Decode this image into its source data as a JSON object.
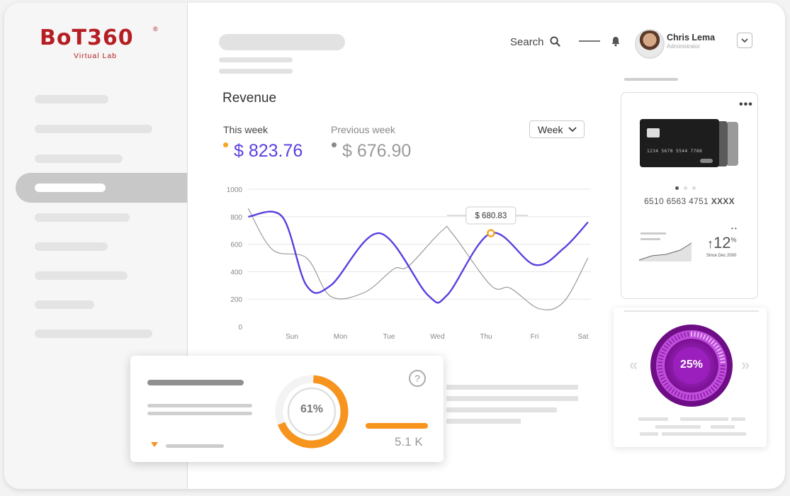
{
  "brand": {
    "name": "BoT360",
    "registered": "®",
    "subtitle": "Virtual Lab",
    "color": "#b51f24"
  },
  "header": {
    "search_label": "Search",
    "user": {
      "name": "Chris Lema",
      "role": "Administrator"
    }
  },
  "revenue": {
    "title": "Revenue",
    "this_week_label": "This week",
    "this_week_value": "$ 823.76",
    "previous_week_label": "Previous week",
    "previous_week_value": "$ 676.90",
    "period_select": "Week",
    "accent": "#5b3fe0",
    "secondary": "#9a9a9a"
  },
  "chart_data": {
    "type": "line",
    "categories": [
      "Sun",
      "Mon",
      "Tue",
      "Wed",
      "Thu",
      "Fri",
      "Sat"
    ],
    "y_ticks": [
      "0",
      "200",
      "400",
      "600",
      "800",
      "1000"
    ],
    "ylim": [
      0,
      1000
    ],
    "grid": true,
    "series": [
      {
        "color": "#5b3fe0",
        "points": [
          [
            -0.9,
            800
          ],
          [
            -0.2,
            800
          ],
          [
            0.3,
            300
          ],
          [
            0.8,
            300
          ],
          [
            1.8,
            680
          ],
          [
            2.8,
            230
          ],
          [
            3.2,
            230
          ],
          [
            4.1,
            680
          ],
          [
            5,
            450
          ],
          [
            5.6,
            570
          ],
          [
            6.1,
            760
          ]
        ]
      },
      {
        "color": "#9a9a9a",
        "points": [
          [
            -0.9,
            860
          ],
          [
            -0.4,
            560
          ],
          [
            0.3,
            500
          ],
          [
            0.8,
            220
          ],
          [
            1.5,
            250
          ],
          [
            2.1,
            420
          ],
          [
            2.4,
            440
          ],
          [
            3.1,
            700
          ],
          [
            3.3,
            680
          ],
          [
            4.1,
            300
          ],
          [
            4.5,
            280
          ],
          [
            5.1,
            130
          ],
          [
            5.6,
            180
          ],
          [
            6.1,
            500
          ]
        ]
      }
    ],
    "tooltip": {
      "label": "$ 680.83",
      "x": 4.1,
      "y": 680
    }
  },
  "stats_card": {
    "donut_percent": 61,
    "donut_label": "61%",
    "value_label": "5.1 K",
    "help_icon": "question-circle-icon",
    "accent": "#f7941d"
  },
  "card_panel": {
    "card_number_small": "1234  5678  5544  7788",
    "account_number": "6510 6563 4751",
    "account_mask": "XXXX",
    "growth_label": "12",
    "growth_unit": "%",
    "since_label": "Since Dec 2000"
  },
  "dial_panel": {
    "percent": 25,
    "label": "25%",
    "color": "#8a1aa8"
  }
}
